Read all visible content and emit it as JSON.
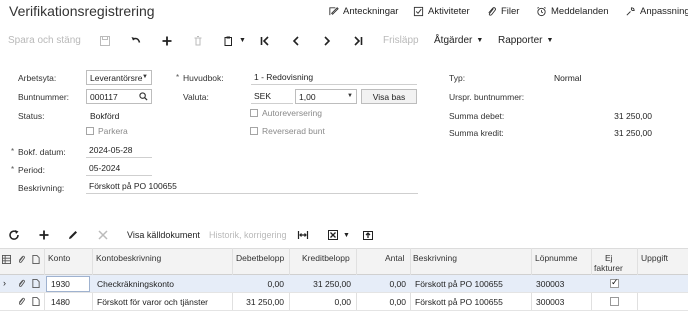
{
  "title": "Verifikationsregistrering",
  "top_links": [
    {
      "label": "Anteckningar",
      "icon": "notes-icon"
    },
    {
      "label": "Aktiviteter",
      "icon": "activities-icon"
    },
    {
      "label": "Filer",
      "icon": "paperclip-icon"
    },
    {
      "label": "Meddelanden",
      "icon": "alarm-icon"
    },
    {
      "label": "Anpassning",
      "icon": "customization-icon"
    }
  ],
  "toolbar": {
    "save_close": "Spara och stäng",
    "release": "Frisläpp",
    "actions": "Åtgärder",
    "reports": "Rapporter"
  },
  "form": {
    "arbetsyta_label": "Arbetsyta:",
    "arbetsyta_value": "Leverantörsre",
    "buntnummer_label": "Buntnummer:",
    "buntnummer_value": "000117",
    "status_label": "Status:",
    "status_value": "Bokförd",
    "parkera_label": "Parkera",
    "bokf_datum_label": "Bokf. datum:",
    "bokf_datum_value": "2024-05-28",
    "period_label": "Period:",
    "period_value": "05-2024",
    "beskrivning_label": "Beskrivning:",
    "beskrivning_value": "Förskott på PO 100655",
    "huvudbok_label": "Huvudbok:",
    "huvudbok_value": "1 - Redovisning",
    "valuta_label": "Valuta:",
    "valuta_code": "SEK",
    "valuta_rate": "1,00",
    "visa_bas": "Visa bas",
    "autoreversering_label": "Autoreversering",
    "reverserad_bunt_label": "Reverserad bunt",
    "typ_label": "Typ:",
    "typ_value": "Normal",
    "urspr_label": "Urspr. buntnummer:",
    "summa_debet_label": "Summa debet:",
    "summa_debet_value": "31 250,00",
    "summa_kredit_label": "Summa kredit:",
    "summa_kredit_value": "31 250,00"
  },
  "grid_toolbar": {
    "visa_kalldokument": "Visa källdokument",
    "historik": "Historik, korrigering"
  },
  "grid": {
    "columns": {
      "konto": "Konto",
      "kontobeskrivning": "Kontobeskrivning",
      "debetbelopp": "Debetbelopp",
      "kreditbelopp": "Kreditbelopp",
      "antal": "Antal",
      "beskrivning": "Beskrivning",
      "lopnummer": "Löpnumme",
      "ej_fakturer_1": "Ej",
      "ej_fakturer_2": "fakturer",
      "uppgift": "Uppgift"
    },
    "rows": [
      {
        "konto": "1930",
        "kontobeskrivning": "Checkräkningskonto",
        "debet": "0,00",
        "kredit": "31 250,00",
        "antal": "0,00",
        "beskrivning": "Förskott på PO 100655",
        "lopnummer": "300003",
        "ej_fakturera": true
      },
      {
        "konto": "1480",
        "kontobeskrivning": "Förskott för varor och tjänster",
        "debet": "31 250,00",
        "kredit": "0,00",
        "antal": "0,00",
        "beskrivning": "Förskott på PO 100655",
        "lopnummer": "300003",
        "ej_fakturera": false
      }
    ]
  }
}
